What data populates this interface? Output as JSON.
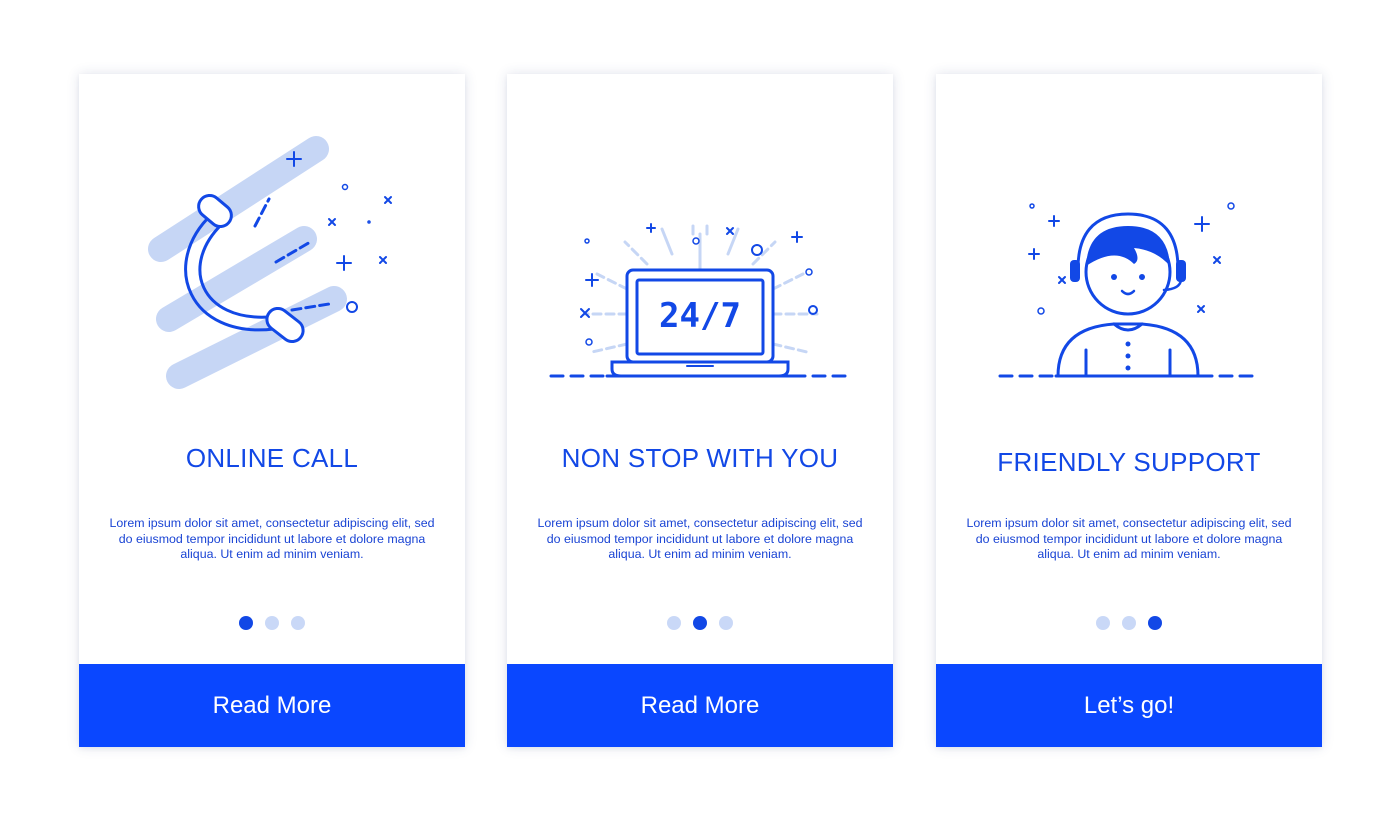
{
  "colors": {
    "accent": "#0a47ff",
    "title": "#1248e6",
    "dot_inactive": "#c9d8f7",
    "illustration_light": "#c6d6f5"
  },
  "cards": [
    {
      "icon": "phone-icon",
      "title": "ONLINE CALL",
      "body": "Lorem ipsum dolor sit amet, consectetur adipiscing elit, sed do eiusmod tempor incididunt ut labore et dolore magna aliqua. Ut enim ad minim veniam.",
      "active_dot": 1,
      "button_label": "Read More"
    },
    {
      "icon": "laptop-24-7-icon",
      "laptop_text": "24/7",
      "title": "NON STOP WITH YOU",
      "body": "Lorem ipsum dolor sit amet, consectetur adipiscing elit, sed do eiusmod tempor incididunt ut labore et dolore magna aliqua. Ut enim ad minim veniam.",
      "active_dot": 2,
      "button_label": "Read More"
    },
    {
      "icon": "support-agent-icon",
      "title": "FRIENDLY SUPPORT",
      "body": "Lorem ipsum dolor sit amet, consectetur adipiscing elit, sed do eiusmod tempor incididunt ut labore et dolore magna aliqua. Ut enim ad minim veniam.",
      "active_dot": 3,
      "button_label": "Let’s go!"
    }
  ]
}
